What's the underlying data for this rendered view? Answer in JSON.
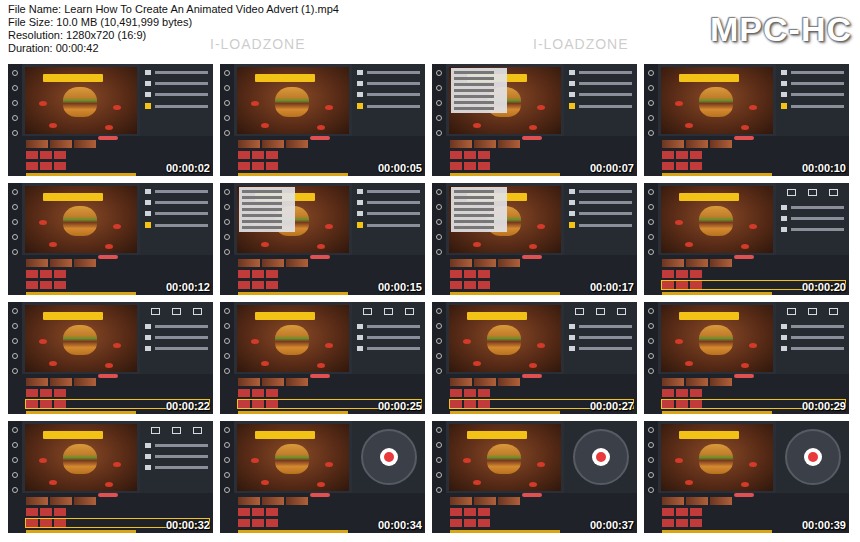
{
  "info": {
    "lines": [
      "File Name: Learn How To Create An Animated Video Advert (1).mp4",
      "File Size: 10.0 MB (10,491,999 bytes)",
      "Resolution: 1280x720 (16:9)",
      "Duration: 00:00:42"
    ]
  },
  "logo": "MPC-HC",
  "watermarks": [
    "I-LOADZONE",
    "I-LOADZONE"
  ],
  "thumbnails": [
    {
      "time": "00:00:02",
      "kind": "panel"
    },
    {
      "time": "00:00:05",
      "kind": "panel"
    },
    {
      "time": "00:00:07",
      "kind": "menu"
    },
    {
      "time": "00:00:10",
      "kind": "panel"
    },
    {
      "time": "00:00:12",
      "kind": "panel"
    },
    {
      "time": "00:00:15",
      "kind": "menu"
    },
    {
      "time": "00:00:17",
      "kind": "menu"
    },
    {
      "time": "00:00:20",
      "kind": "clip"
    },
    {
      "time": "00:00:22",
      "kind": "clip"
    },
    {
      "time": "00:00:25",
      "kind": "clip"
    },
    {
      "time": "00:00:27",
      "kind": "clip"
    },
    {
      "time": "00:00:29",
      "kind": "clip"
    },
    {
      "time": "00:00:32",
      "kind": "clip"
    },
    {
      "time": "00:00:34",
      "kind": "wheel"
    },
    {
      "time": "00:00:37",
      "kind": "wheel"
    },
    {
      "time": "00:00:39",
      "kind": "wheel"
    }
  ]
}
